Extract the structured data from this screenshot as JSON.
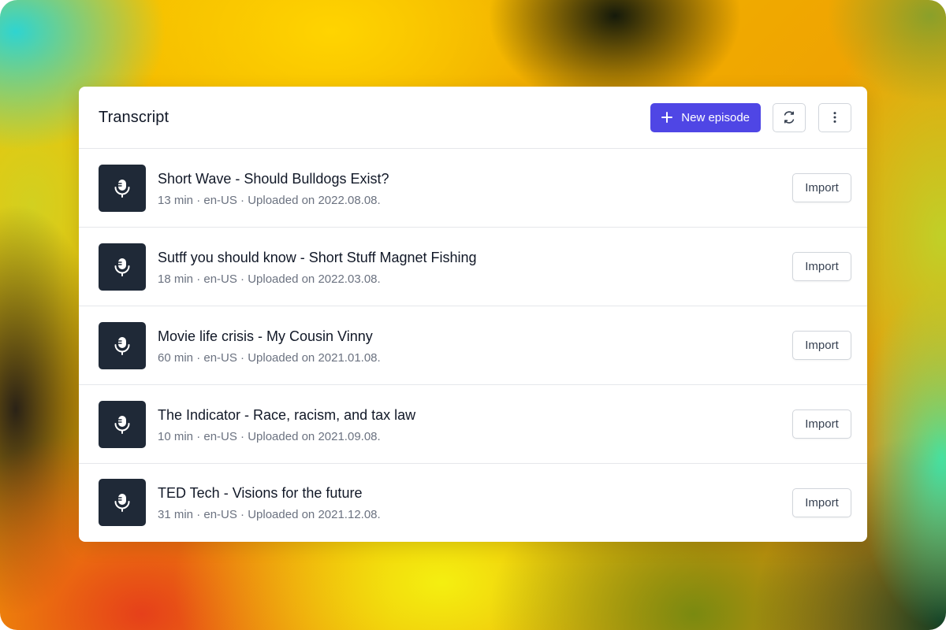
{
  "header": {
    "title": "Transcript",
    "new_episode_label": "New episode",
    "refresh_icon": "refresh-icon",
    "more_icon": "more-vertical-icon"
  },
  "colors": {
    "accent": "#4f46e5",
    "thumb_bg": "#1f2937"
  },
  "episodes": [
    {
      "title": "Short Wave - Should Bulldogs Exist?",
      "meta": "13 min · en-US · Uploaded on 2022.08.08.",
      "action": "Import",
      "icon": "microphone-icon"
    },
    {
      "title": "Sutff you should know - Short Stuff Magnet Fishing",
      "meta": "18 min · en-US · Uploaded on 2022.03.08.",
      "action": "Import",
      "icon": "microphone-icon"
    },
    {
      "title": "Movie life crisis - My Cousin Vinny",
      "meta": "60 min · en-US · Uploaded on 2021.01.08.",
      "action": "Import",
      "icon": "microphone-icon"
    },
    {
      "title": "The Indicator - Race, racism, and tax law",
      "meta": "10 min · en-US · Uploaded on 2021.09.08.",
      "action": "Import",
      "icon": "microphone-icon"
    },
    {
      "title": "TED Tech - Visions for the future",
      "meta": "31 min · en-US · Uploaded on 2021.12.08.",
      "action": "Import",
      "icon": "microphone-icon"
    }
  ]
}
